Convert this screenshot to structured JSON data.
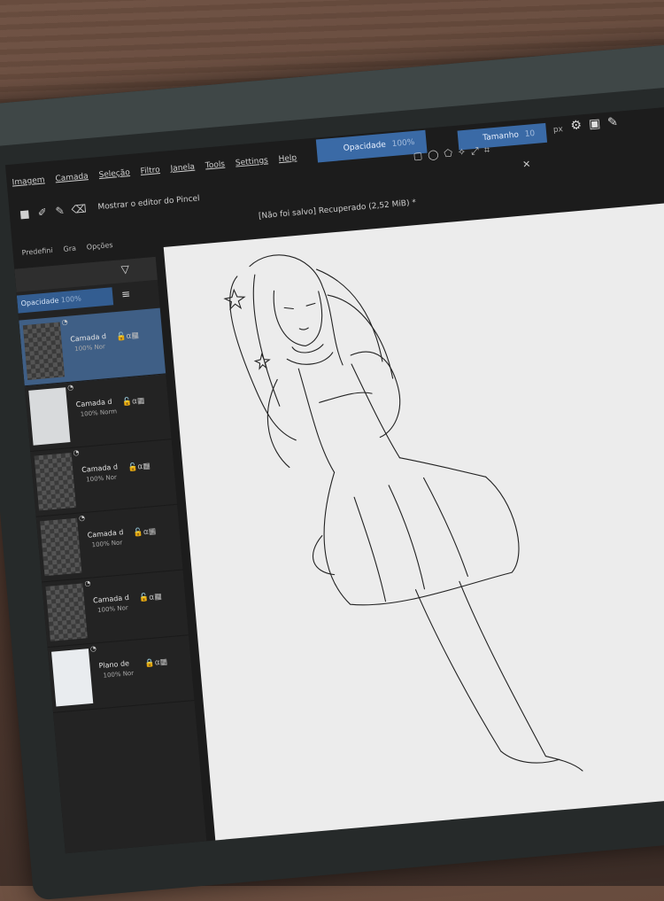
{
  "menu": {
    "items": [
      "Imagem",
      "Camada",
      "Seleção",
      "Filtro",
      "Janela",
      "Tools",
      "Settings",
      "Help"
    ]
  },
  "top": {
    "opacity_label": "Opacidade",
    "opacity_value": "100%",
    "size_label": "Tamanho",
    "size_value": "10",
    "size_unit": "px"
  },
  "toolbar": {
    "brush_editor_label": "Mostrar o editor do Pincel"
  },
  "document": {
    "status": "[Não foi salvo]",
    "name": "Recuperado",
    "size": "(2,52 MiB)",
    "modified": "*"
  },
  "panel_tabs": [
    "Predefini",
    "Gra",
    "Opções"
  ],
  "layers_panel": {
    "opacity_label": "Opacidade",
    "opacity_value": "100%"
  },
  "layers": [
    {
      "name": "Camada d",
      "blend": "100% Nor",
      "selected": true,
      "thumb": "checker"
    },
    {
      "name": "Camada d",
      "blend": "100% Norm",
      "selected": false,
      "thumb": "sketch"
    },
    {
      "name": "Camada d",
      "blend": "100% Nor",
      "selected": false,
      "thumb": "checker"
    },
    {
      "name": "Camada d",
      "blend": "100% Nor",
      "selected": false,
      "thumb": "checker"
    },
    {
      "name": "Camada d",
      "blend": "100% Nor",
      "selected": false,
      "thumb": "checker"
    },
    {
      "name": "Plano de",
      "blend": "100% Nor",
      "selected": false,
      "thumb": "light"
    }
  ],
  "colors": {
    "accent": "#3a6aa6",
    "panel": "#232323",
    "canvas": "#ececec"
  }
}
